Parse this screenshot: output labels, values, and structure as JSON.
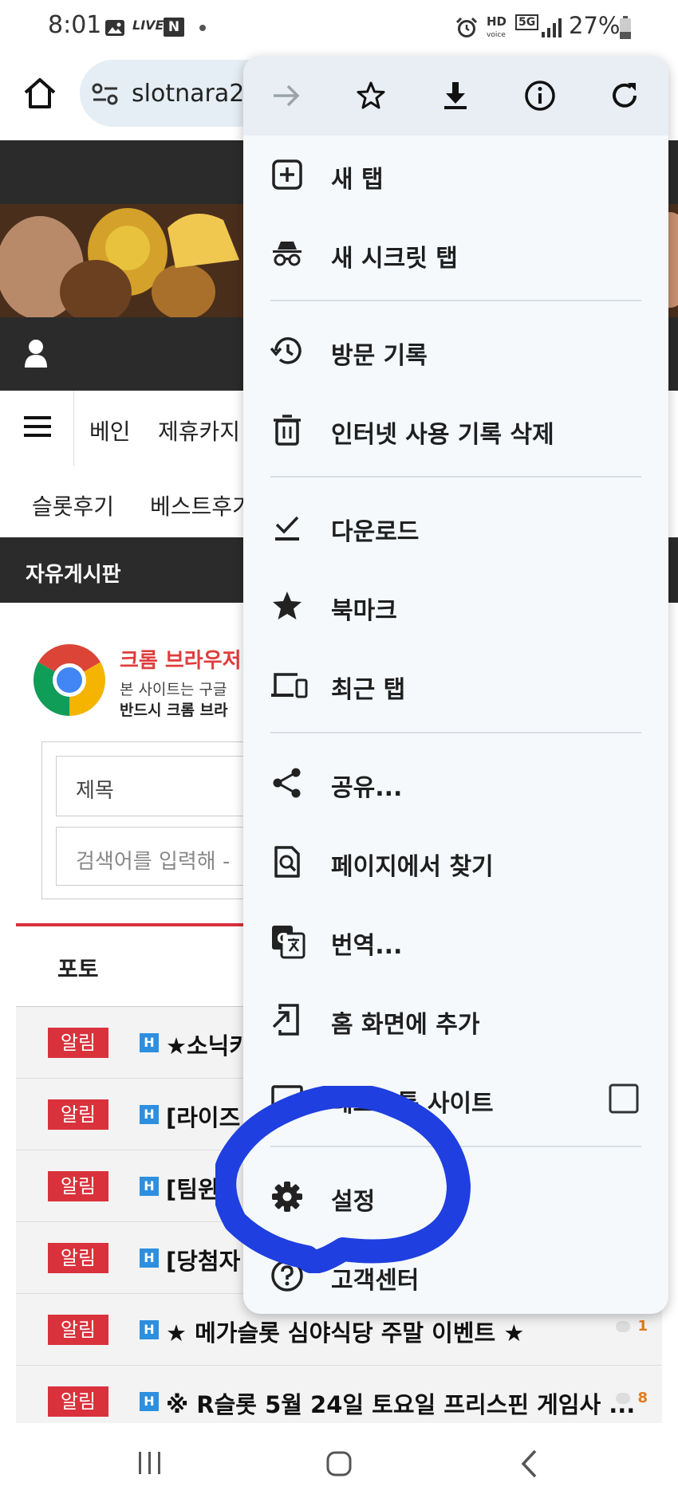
{
  "status_bar": {
    "time": "8:01",
    "live_label": "LIVE",
    "n_label": "N",
    "hd_label": "HD",
    "voice_label": "voice",
    "network_label": "5G",
    "battery": "27%"
  },
  "browser": {
    "url": "slotnara2"
  },
  "site": {
    "nav_items": [
      "베인",
      "제휴카지"
    ],
    "sub_nav_items": [
      "슬롯후기",
      "베스트후기"
    ],
    "board_title": "자유게시판",
    "chrome_notice": {
      "title": "크롬 브라우저",
      "line1": "본 사이트는 구글",
      "line2": "반드시 크롬 브라"
    },
    "search": {
      "field_selected": "제목",
      "placeholder": "검색어를 입력해 -"
    },
    "tab_label": "포토",
    "posts": [
      {
        "badge": "알림",
        "title": "★소닉카",
        "comments": ""
      },
      {
        "badge": "알림",
        "title": "[라이즈",
        "comments": ""
      },
      {
        "badge": "알림",
        "title": "[팀윈",
        "comments": ""
      },
      {
        "badge": "알림",
        "title": "[당첨자",
        "comments": ""
      },
      {
        "badge": "알림",
        "title": "★ 메가슬롯 심야식당 주말 이벤트 ★",
        "comments": "1"
      },
      {
        "badge": "알림",
        "title": "※ R슬롯 5월 24일 토요일 프리스핀 게임사 ...",
        "comments": "8"
      }
    ],
    "h_icon_label": "H"
  },
  "menu": {
    "toolbar": [
      "forward-icon",
      "bookmark-star-icon",
      "download-icon",
      "info-icon",
      "refresh-icon"
    ],
    "items": [
      {
        "label": "새 탭",
        "icon": "new-tab-icon"
      },
      {
        "label": "새 시크릿 탭",
        "icon": "incognito-icon"
      },
      {
        "label": "방문 기록",
        "icon": "history-icon"
      },
      {
        "label": "인터넷 사용 기록 삭제",
        "icon": "trash-icon"
      },
      {
        "label": "다운로드",
        "icon": "downloads-check-icon"
      },
      {
        "label": "북마크",
        "icon": "star-icon"
      },
      {
        "label": "최근 탭",
        "icon": "devices-icon"
      },
      {
        "label": "공유...",
        "icon": "share-icon"
      },
      {
        "label": "페이지에서 찾기",
        "icon": "find-in-page-icon"
      },
      {
        "label": "번역...",
        "icon": "translate-icon"
      },
      {
        "label": "홈 화면에 추가",
        "icon": "add-to-home-icon"
      },
      {
        "label": "데스크톱 사이트",
        "icon": "desktop-icon"
      },
      {
        "label": "설정",
        "icon": "gear-icon"
      },
      {
        "label": "고객센터",
        "icon": "help-icon"
      }
    ]
  },
  "annotation_color": "#1f3fe0"
}
